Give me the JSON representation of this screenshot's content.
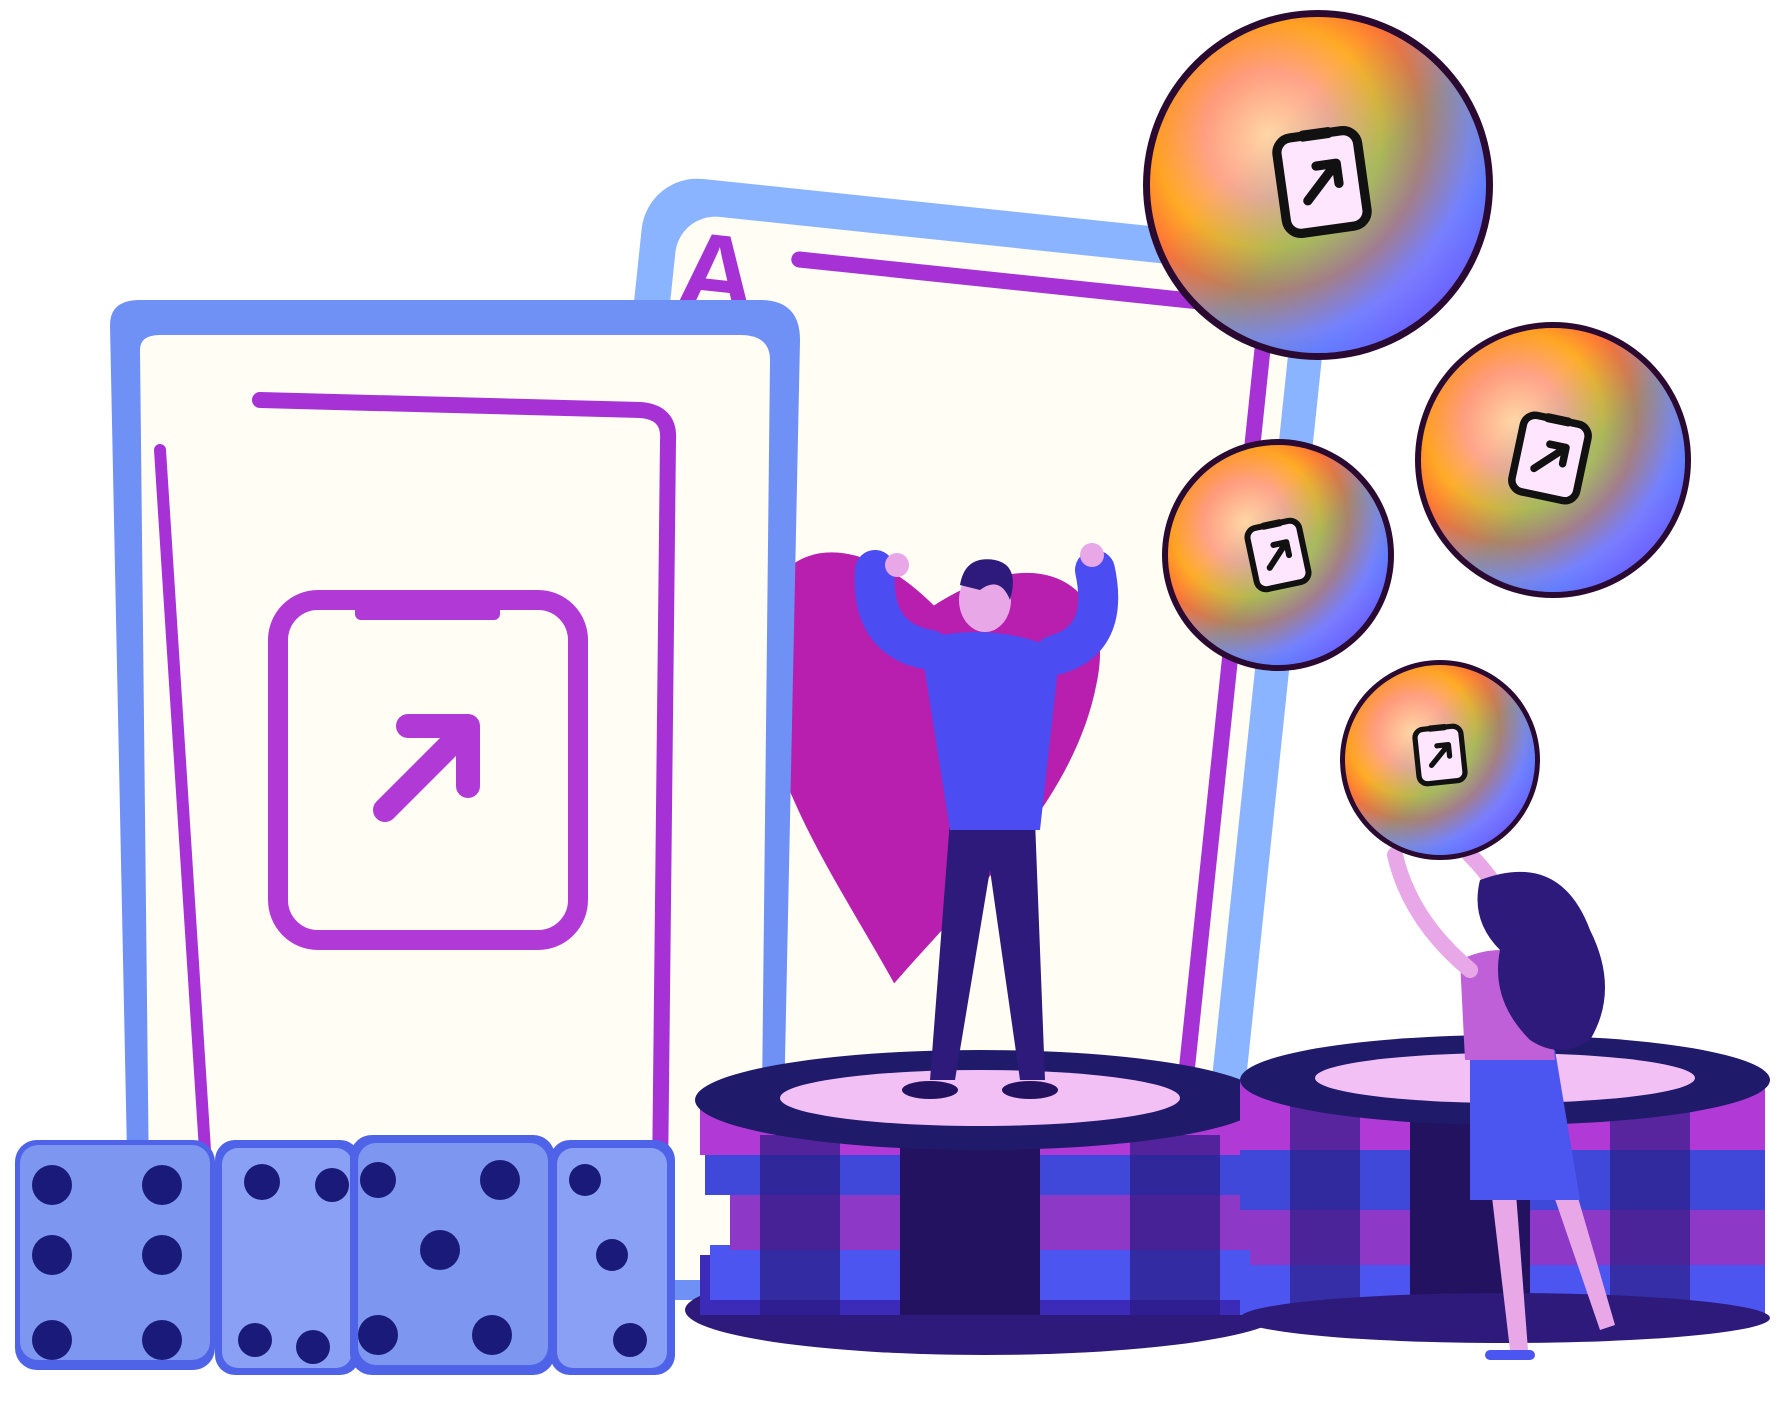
{
  "scene": {
    "ace_card_rank": "A",
    "icon": "arrow-up-right-in-phone-icon",
    "colors": {
      "background": "#ffffff",
      "card_face": "#fffdf4",
      "card_border": "#7aa7f5",
      "purple": "#a632d6",
      "magenta": "#b81fae",
      "indigo": "#2d1a7a",
      "blue": "#4b55f0",
      "dice": "#7d96f0",
      "dice_pip": "#1a1a7a"
    }
  }
}
